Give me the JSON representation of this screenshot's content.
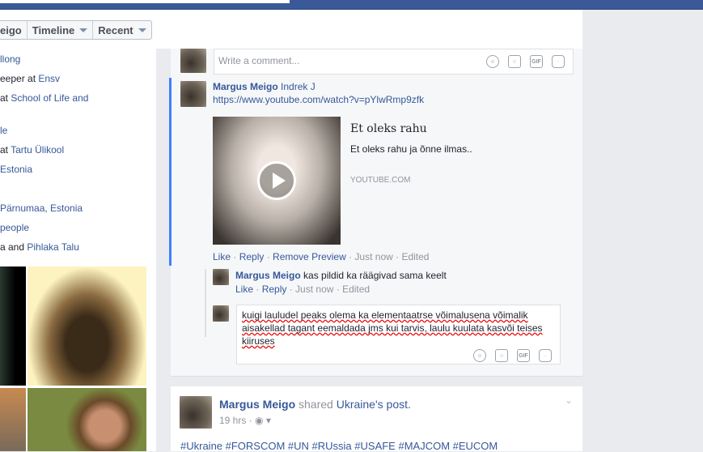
{
  "nav": {
    "name_partial": "eigo",
    "timeline": "Timeline",
    "recent": "Recent"
  },
  "intro": [
    {
      "pre": "",
      "link": "llong"
    },
    {
      "pre": "eeper at ",
      "link": "Ensv"
    },
    {
      "pre": " at ",
      "link": "School of Life and"
    },
    {
      "pre": "",
      "link": "le"
    },
    {
      "pre": "at ",
      "link": "Tartu Ülikool"
    },
    {
      "pre": "",
      "link": "Estonia"
    },
    {
      "pre": "",
      "link": "Pärnumaa, Estonia"
    },
    {
      "pre": "",
      "link": "people"
    },
    {
      "pre": "a and ",
      "link": "Pihlaka Talu"
    }
  ],
  "comment_box": {
    "placeholder": "Write a comment..."
  },
  "comment1": {
    "author": "Margus Meigo",
    "mention": "Indrek J",
    "url": "https://www.youtube.com/watch?v=pYlwRmp9zfk",
    "preview": {
      "title": "Et oleks rahu",
      "description": "Et oleks rahu ja õnne ilmas..",
      "domain": "YOUTUBE.COM"
    },
    "actions": {
      "like": "Like",
      "reply": "Reply",
      "remove": "Remove Preview",
      "time": "Just now",
      "edited": "Edited"
    }
  },
  "reply1": {
    "author": "Margus Meigo",
    "text": "kas pildid ka räägivad sama keelt",
    "actions": {
      "like": "Like",
      "reply": "Reply",
      "time": "Just now",
      "edited": "Edited"
    }
  },
  "reply_draft": {
    "text": "kuigi lauludel peaks olema ka elementaatrse võimalusena võimalik aisakellad tagant eemaldada jms kui tarvis, laulu kuulata kasvõi teises kiiruses"
  },
  "post2": {
    "author": "Margus Meigo",
    "shared": "shared",
    "page": "Ukraine",
    "post_suffix": "'s post.",
    "time": "19 hrs",
    "hashtags": "#Ukraine #FORSCOM #UN #RUssia #USAFE #MAJCOM #EUCOM"
  }
}
